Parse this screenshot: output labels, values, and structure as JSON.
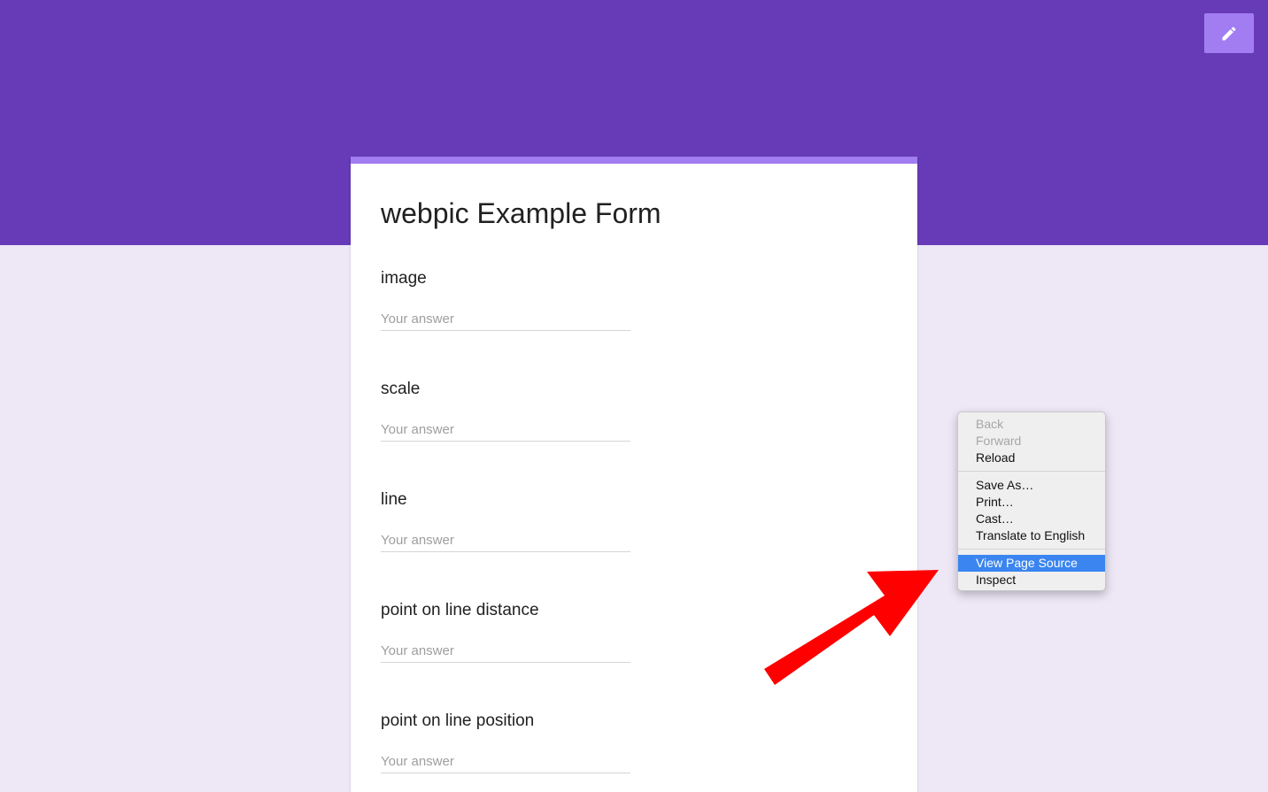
{
  "header": {
    "color": "#673ab7",
    "edit_icon": "pencil-icon"
  },
  "form": {
    "title": "webpic Example Form",
    "accent_color": "#a27df2",
    "questions": [
      {
        "label": "image",
        "placeholder": "Your answer"
      },
      {
        "label": "scale",
        "placeholder": "Your answer"
      },
      {
        "label": "line",
        "placeholder": "Your answer"
      },
      {
        "label": "point on line distance",
        "placeholder": "Your answer"
      },
      {
        "label": "point on line position",
        "placeholder": "Your answer"
      }
    ]
  },
  "context_menu": {
    "groups": [
      [
        {
          "label": "Back",
          "enabled": false
        },
        {
          "label": "Forward",
          "enabled": false
        },
        {
          "label": "Reload",
          "enabled": true
        }
      ],
      [
        {
          "label": "Save As…",
          "enabled": true
        },
        {
          "label": "Print…",
          "enabled": true
        },
        {
          "label": "Cast…",
          "enabled": true
        },
        {
          "label": "Translate to English",
          "enabled": true
        }
      ],
      [
        {
          "label": "View Page Source",
          "enabled": true,
          "highlighted": true
        },
        {
          "label": "Inspect",
          "enabled": true
        }
      ]
    ],
    "highlight_color": "#3a85f0"
  },
  "annotation": {
    "arrow_color": "#ff0000",
    "arrow_icon": "red-arrow-icon"
  }
}
